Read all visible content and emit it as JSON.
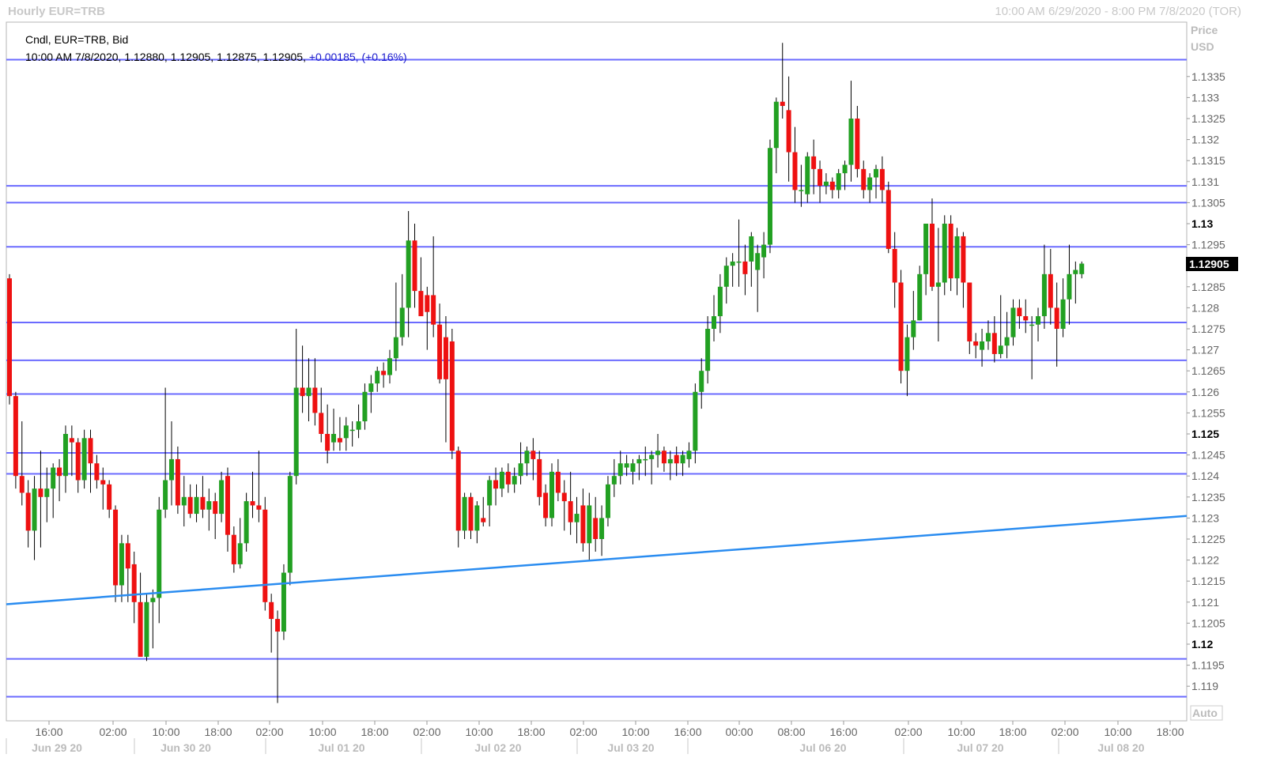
{
  "header": {
    "title": "Hourly EUR=TRB",
    "range": "10:00 AM 6/29/2020 - 8:00 PM 7/8/2020 (TOR)"
  },
  "legend": {
    "line1": "Cndl, EUR=TRB, Bid",
    "ohlc": "10:00 AM 7/8/2020, 1.12880, 1.12905, 1.12875, 1.12905,",
    "change": "+0.00185,",
    "change_pct": "(+0.16%)"
  },
  "axis": {
    "price_label": "Price",
    "currency_label": "USD",
    "auto_label": "Auto",
    "last_price": "1.12905"
  },
  "colors": {
    "up": "#22a022",
    "down": "#ee1111",
    "hline": "#6b6bff",
    "trendline": "#2a8cf0",
    "grid": "#dcdcdc",
    "last_price_bg": "#000000"
  },
  "chart_data": {
    "type": "candlestick",
    "title": "Hourly EUR=TRB",
    "ylim": [
      1.1185,
      1.1345
    ],
    "y_ticks": [
      "1.119",
      "1.1195",
      "1.12",
      "1.1205",
      "1.121",
      "1.1215",
      "1.122",
      "1.1225",
      "1.123",
      "1.1235",
      "1.124",
      "1.1245",
      "1.125",
      "1.1255",
      "1.126",
      "1.1265",
      "1.127",
      "1.1275",
      "1.128",
      "1.1285",
      "1.129",
      "1.1295",
      "1.13",
      "1.1305",
      "1.131",
      "1.1315",
      "1.132",
      "1.1325",
      "1.133",
      "1.1335"
    ],
    "bold_ticks": [
      "1.12",
      "1.125",
      "1.13"
    ],
    "x_time_ticks": [
      "16:00",
      "02:00",
      "10:00",
      "18:00",
      "02:00",
      "10:00",
      "18:00",
      "02:00",
      "10:00",
      "18:00",
      "02:00",
      "10:00",
      "16:00",
      "00:00",
      "08:00",
      "16:00",
      "02:00",
      "10:00",
      "18:00",
      "02:00",
      "10:00",
      "18:00"
    ],
    "x_date_ticks": [
      "Jun 29 20",
      "Jun 30 20",
      "Jul 01 20",
      "Jul 02 20",
      "Jul 03 20",
      "Jul 06 20",
      "Jul 07 20",
      "Jul 08 20"
    ],
    "horizontal_lines": [
      1.1339,
      1.1309,
      1.1305,
      1.12945,
      1.12765,
      1.12675,
      1.12595,
      1.12455,
      1.12405,
      1.11965,
      1.11875
    ],
    "trendline": {
      "start": 1.12095,
      "end": 1.12305
    },
    "candles": [
      {
        "o": 1.1287,
        "h": 1.1288,
        "l": 1.1257,
        "c": 1.1259
      },
      {
        "o": 1.1259,
        "h": 1.126,
        "l": 1.1237,
        "c": 1.124
      },
      {
        "o": 1.124,
        "h": 1.1253,
        "l": 1.1233,
        "c": 1.1236
      },
      {
        "o": 1.1236,
        "h": 1.1239,
        "l": 1.1223,
        "c": 1.1227
      },
      {
        "o": 1.1227,
        "h": 1.124,
        "l": 1.122,
        "c": 1.1237
      },
      {
        "o": 1.1237,
        "h": 1.1246,
        "l": 1.1223,
        "c": 1.1235
      },
      {
        "o": 1.1235,
        "h": 1.1242,
        "l": 1.1229,
        "c": 1.1237
      },
      {
        "o": 1.1237,
        "h": 1.1243,
        "l": 1.123,
        "c": 1.1242
      },
      {
        "o": 1.1242,
        "h": 1.1244,
        "l": 1.1234,
        "c": 1.124
      },
      {
        "o": 1.124,
        "h": 1.1252,
        "l": 1.1236,
        "c": 1.125
      },
      {
        "o": 1.1249,
        "h": 1.1252,
        "l": 1.124,
        "c": 1.1248
      },
      {
        "o": 1.1248,
        "h": 1.1249,
        "l": 1.1236,
        "c": 1.1239
      },
      {
        "o": 1.1239,
        "h": 1.1251,
        "l": 1.1237,
        "c": 1.1249
      },
      {
        "o": 1.1249,
        "h": 1.1251,
        "l": 1.1236,
        "c": 1.1243
      },
      {
        "o": 1.1243,
        "h": 1.1245,
        "l": 1.1237,
        "c": 1.1239
      },
      {
        "o": 1.1239,
        "h": 1.1242,
        "l": 1.1232,
        "c": 1.1238
      },
      {
        "o": 1.1238,
        "h": 1.1239,
        "l": 1.123,
        "c": 1.1232
      },
      {
        "o": 1.1232,
        "h": 1.1233,
        "l": 1.121,
        "c": 1.1214
      },
      {
        "o": 1.1214,
        "h": 1.1226,
        "l": 1.121,
        "c": 1.1224
      },
      {
        "o": 1.1224,
        "h": 1.1226,
        "l": 1.121,
        "c": 1.1218
      },
      {
        "o": 1.1219,
        "h": 1.1222,
        "l": 1.1205,
        "c": 1.121
      },
      {
        "o": 1.121,
        "h": 1.1217,
        "l": 1.1198,
        "c": 1.1197
      },
      {
        "o": 1.1197,
        "h": 1.1212,
        "l": 1.1196,
        "c": 1.121
      },
      {
        "o": 1.121,
        "h": 1.1213,
        "l": 1.1199,
        "c": 1.1211
      },
      {
        "o": 1.1211,
        "h": 1.1235,
        "l": 1.1205,
        "c": 1.1232
      },
      {
        "o": 1.1232,
        "h": 1.1261,
        "l": 1.123,
        "c": 1.1239
      },
      {
        "o": 1.1239,
        "h": 1.1253,
        "l": 1.1233,
        "c": 1.1244
      },
      {
        "o": 1.1244,
        "h": 1.1247,
        "l": 1.1231,
        "c": 1.1233
      },
      {
        "o": 1.1233,
        "h": 1.124,
        "l": 1.1228,
        "c": 1.1235
      },
      {
        "o": 1.1235,
        "h": 1.1238,
        "l": 1.123,
        "c": 1.1231
      },
      {
        "o": 1.1231,
        "h": 1.1238,
        "l": 1.1229,
        "c": 1.1235
      },
      {
        "o": 1.1235,
        "h": 1.124,
        "l": 1.123,
        "c": 1.1232
      },
      {
        "o": 1.1232,
        "h": 1.1237,
        "l": 1.1227,
        "c": 1.1234
      },
      {
        "o": 1.1234,
        "h": 1.1236,
        "l": 1.1225,
        "c": 1.1231
      },
      {
        "o": 1.1231,
        "h": 1.1241,
        "l": 1.1229,
        "c": 1.1239
      },
      {
        "o": 1.124,
        "h": 1.1242,
        "l": 1.1222,
        "c": 1.1226
      },
      {
        "o": 1.1226,
        "h": 1.1228,
        "l": 1.1217,
        "c": 1.1219
      },
      {
        "o": 1.1219,
        "h": 1.123,
        "l": 1.1218,
        "c": 1.1224
      },
      {
        "o": 1.1224,
        "h": 1.1236,
        "l": 1.1222,
        "c": 1.1234
      },
      {
        "o": 1.1234,
        "h": 1.1241,
        "l": 1.123,
        "c": 1.1233
      },
      {
        "o": 1.1233,
        "h": 1.1246,
        "l": 1.1229,
        "c": 1.1232
      },
      {
        "o": 1.1232,
        "h": 1.1235,
        "l": 1.1208,
        "c": 1.121
      },
      {
        "o": 1.121,
        "h": 1.1212,
        "l": 1.1198,
        "c": 1.1206
      },
      {
        "o": 1.1206,
        "h": 1.1208,
        "l": 1.1186,
        "c": 1.1203
      },
      {
        "o": 1.1203,
        "h": 1.1219,
        "l": 1.1201,
        "c": 1.1217
      },
      {
        "o": 1.1217,
        "h": 1.1241,
        "l": 1.1214,
        "c": 1.124
      },
      {
        "o": 1.124,
        "h": 1.1275,
        "l": 1.1238,
        "c": 1.1261
      },
      {
        "o": 1.1261,
        "h": 1.1271,
        "l": 1.1255,
        "c": 1.1259
      },
      {
        "o": 1.1259,
        "h": 1.1268,
        "l": 1.1253,
        "c": 1.1261
      },
      {
        "o": 1.1261,
        "h": 1.1268,
        "l": 1.1252,
        "c": 1.1255
      },
      {
        "o": 1.1255,
        "h": 1.1261,
        "l": 1.1248,
        "c": 1.125
      },
      {
        "o": 1.125,
        "h": 1.1257,
        "l": 1.1243,
        "c": 1.1246
      },
      {
        "o": 1.1248,
        "h": 1.1256,
        "l": 1.1246,
        "c": 1.125
      },
      {
        "o": 1.1249,
        "h": 1.1254,
        "l": 1.1246,
        "c": 1.1248
      },
      {
        "o": 1.1249,
        "h": 1.1254,
        "l": 1.1246,
        "c": 1.1252
      },
      {
        "o": 1.1251,
        "h": 1.1253,
        "l": 1.1247,
        "c": 1.1251
      },
      {
        "o": 1.1251,
        "h": 1.1257,
        "l": 1.1249,
        "c": 1.1253
      },
      {
        "o": 1.1253,
        "h": 1.1262,
        "l": 1.1251,
        "c": 1.126
      },
      {
        "o": 1.126,
        "h": 1.1264,
        "l": 1.1255,
        "c": 1.1262
      },
      {
        "o": 1.1262,
        "h": 1.1266,
        "l": 1.126,
        "c": 1.1265
      },
      {
        "o": 1.1265,
        "h": 1.1267,
        "l": 1.1261,
        "c": 1.1264
      },
      {
        "o": 1.1264,
        "h": 1.127,
        "l": 1.1262,
        "c": 1.1268
      },
      {
        "o": 1.1268,
        "h": 1.1286,
        "l": 1.1265,
        "c": 1.1273
      },
      {
        "o": 1.1273,
        "h": 1.1288,
        "l": 1.1271,
        "c": 1.128
      },
      {
        "o": 1.128,
        "h": 1.1303,
        "l": 1.1273,
        "c": 1.1296
      },
      {
        "o": 1.1296,
        "h": 1.13,
        "l": 1.128,
        "c": 1.1284
      },
      {
        "o": 1.1284,
        "h": 1.1292,
        "l": 1.128,
        "c": 1.1278
      },
      {
        "o": 1.1283,
        "h": 1.1285,
        "l": 1.127,
        "c": 1.1279
      },
      {
        "o": 1.1283,
        "h": 1.1297,
        "l": 1.1273,
        "c": 1.1276
      },
      {
        "o": 1.1276,
        "h": 1.1281,
        "l": 1.1262,
        "c": 1.1263
      },
      {
        "o": 1.1273,
        "h": 1.1278,
        "l": 1.1248,
        "c": 1.1263
      },
      {
        "o": 1.1272,
        "h": 1.1275,
        "l": 1.1244,
        "c": 1.1246
      },
      {
        "o": 1.1246,
        "h": 1.1247,
        "l": 1.1223,
        "c": 1.1227
      },
      {
        "o": 1.1227,
        "h": 1.1236,
        "l": 1.1225,
        "c": 1.1235
      },
      {
        "o": 1.1235,
        "h": 1.1236,
        "l": 1.1225,
        "c": 1.1227
      },
      {
        "o": 1.1227,
        "h": 1.1234,
        "l": 1.1224,
        "c": 1.1233
      },
      {
        "o": 1.123,
        "h": 1.1235,
        "l": 1.1228,
        "c": 1.1229
      },
      {
        "o": 1.1233,
        "h": 1.124,
        "l": 1.1228,
        "c": 1.1239
      },
      {
        "o": 1.1239,
        "h": 1.1242,
        "l": 1.1233,
        "c": 1.1237
      },
      {
        "o": 1.1237,
        "h": 1.1242,
        "l": 1.1235,
        "c": 1.1241
      },
      {
        "o": 1.1241,
        "h": 1.1243,
        "l": 1.1236,
        "c": 1.1238
      },
      {
        "o": 1.1238,
        "h": 1.1242,
        "l": 1.1236,
        "c": 1.124
      },
      {
        "o": 1.124,
        "h": 1.1248,
        "l": 1.1238,
        "c": 1.1243
      },
      {
        "o": 1.1243,
        "h": 1.1247,
        "l": 1.124,
        "c": 1.1246
      },
      {
        "o": 1.1246,
        "h": 1.1249,
        "l": 1.1239,
        "c": 1.1244
      },
      {
        "o": 1.1244,
        "h": 1.1246,
        "l": 1.1233,
        "c": 1.1235
      },
      {
        "o": 1.1236,
        "h": 1.1238,
        "l": 1.1228,
        "c": 1.123
      },
      {
        "o": 1.123,
        "h": 1.1243,
        "l": 1.1228,
        "c": 1.1241
      },
      {
        "o": 1.1241,
        "h": 1.1244,
        "l": 1.1234,
        "c": 1.1236
      },
      {
        "o": 1.1236,
        "h": 1.1239,
        "l": 1.1227,
        "c": 1.1234
      },
      {
        "o": 1.1234,
        "h": 1.1241,
        "l": 1.1226,
        "c": 1.1229
      },
      {
        "o": 1.1229,
        "h": 1.1235,
        "l": 1.1224,
        "c": 1.1231
      },
      {
        "o": 1.1233,
        "h": 1.1237,
        "l": 1.1222,
        "c": 1.1224
      },
      {
        "o": 1.1224,
        "h": 1.1236,
        "l": 1.122,
        "c": 1.1233
      },
      {
        "o": 1.123,
        "h": 1.1235,
        "l": 1.1222,
        "c": 1.1225
      },
      {
        "o": 1.1225,
        "h": 1.1233,
        "l": 1.1221,
        "c": 1.123
      },
      {
        "o": 1.123,
        "h": 1.124,
        "l": 1.1228,
        "c": 1.1238
      },
      {
        "o": 1.1238,
        "h": 1.1244,
        "l": 1.1235,
        "c": 1.124
      },
      {
        "o": 1.124,
        "h": 1.1246,
        "l": 1.1238,
        "c": 1.1243
      },
      {
        "o": 1.1242,
        "h": 1.1245,
        "l": 1.124,
        "c": 1.1243
      },
      {
        "o": 1.1241,
        "h": 1.1244,
        "l": 1.1238,
        "c": 1.1243
      },
      {
        "o": 1.1243,
        "h": 1.1245,
        "l": 1.1239,
        "c": 1.1244
      },
      {
        "o": 1.1244,
        "h": 1.1247,
        "l": 1.124,
        "c": 1.1244
      },
      {
        "o": 1.1244,
        "h": 1.1246,
        "l": 1.1238,
        "c": 1.1245
      },
      {
        "o": 1.1245,
        "h": 1.125,
        "l": 1.1242,
        "c": 1.1246
      },
      {
        "o": 1.1246,
        "h": 1.1247,
        "l": 1.1241,
        "c": 1.1243
      },
      {
        "o": 1.1243,
        "h": 1.1246,
        "l": 1.1239,
        "c": 1.1244
      },
      {
        "o": 1.1245,
        "h": 1.1247,
        "l": 1.124,
        "c": 1.1243
      },
      {
        "o": 1.1243,
        "h": 1.1246,
        "l": 1.124,
        "c": 1.1245
      },
      {
        "o": 1.1244,
        "h": 1.1248,
        "l": 1.1242,
        "c": 1.1246
      },
      {
        "o": 1.1246,
        "h": 1.1262,
        "l": 1.1243,
        "c": 1.126
      },
      {
        "o": 1.126,
        "h": 1.1268,
        "l": 1.1256,
        "c": 1.1265
      },
      {
        "o": 1.1265,
        "h": 1.1278,
        "l": 1.1262,
        "c": 1.1275
      },
      {
        "o": 1.1275,
        "h": 1.1283,
        "l": 1.1272,
        "c": 1.1278
      },
      {
        "o": 1.1278,
        "h": 1.1288,
        "l": 1.1274,
        "c": 1.1285
      },
      {
        "o": 1.1285,
        "h": 1.1292,
        "l": 1.1281,
        "c": 1.129
      },
      {
        "o": 1.129,
        "h": 1.1293,
        "l": 1.1285,
        "c": 1.1291
      },
      {
        "o": 1.1291,
        "h": 1.1301,
        "l": 1.1285,
        "c": 1.1291
      },
      {
        "o": 1.1291,
        "h": 1.1295,
        "l": 1.1283,
        "c": 1.1288
      },
      {
        "o": 1.1291,
        "h": 1.1298,
        "l": 1.1285,
        "c": 1.1297
      },
      {
        "o": 1.1289,
        "h": 1.1295,
        "l": 1.1279,
        "c": 1.1293
      },
      {
        "o": 1.1292,
        "h": 1.1298,
        "l": 1.1287,
        "c": 1.1295
      },
      {
        "o": 1.1295,
        "h": 1.132,
        "l": 1.1293,
        "c": 1.1318
      },
      {
        "o": 1.1318,
        "h": 1.133,
        "l": 1.1312,
        "c": 1.1329
      },
      {
        "o": 1.1329,
        "h": 1.1343,
        "l": 1.1325,
        "c": 1.1328
      },
      {
        "o": 1.1327,
        "h": 1.1335,
        "l": 1.131,
        "c": 1.1317
      },
      {
        "o": 1.1317,
        "h": 1.1323,
        "l": 1.1305,
        "c": 1.1308
      },
      {
        "o": 1.1308,
        "h": 1.1314,
        "l": 1.1304,
        "c": 1.1308
      },
      {
        "o": 1.1307,
        "h": 1.1317,
        "l": 1.1305,
        "c": 1.1316
      },
      {
        "o": 1.1316,
        "h": 1.132,
        "l": 1.1307,
        "c": 1.1313
      },
      {
        "o": 1.1313,
        "h": 1.1315,
        "l": 1.1305,
        "c": 1.1309
      },
      {
        "o": 1.1309,
        "h": 1.1312,
        "l": 1.1307,
        "c": 1.131
      },
      {
        "o": 1.131,
        "h": 1.1311,
        "l": 1.1306,
        "c": 1.1308
      },
      {
        "o": 1.1308,
        "h": 1.1313,
        "l": 1.1306,
        "c": 1.1312
      },
      {
        "o": 1.1312,
        "h": 1.1315,
        "l": 1.1308,
        "c": 1.1314
      },
      {
        "o": 1.1314,
        "h": 1.1334,
        "l": 1.131,
        "c": 1.1325
      },
      {
        "o": 1.1325,
        "h": 1.1328,
        "l": 1.1311,
        "c": 1.1313
      },
      {
        "o": 1.1313,
        "h": 1.1315,
        "l": 1.1306,
        "c": 1.1308
      },
      {
        "o": 1.1308,
        "h": 1.1312,
        "l": 1.1305,
        "c": 1.1311
      },
      {
        "o": 1.1311,
        "h": 1.1314,
        "l": 1.1306,
        "c": 1.1313
      },
      {
        "o": 1.1313,
        "h": 1.1316,
        "l": 1.1305,
        "c": 1.1308
      },
      {
        "o": 1.1308,
        "h": 1.131,
        "l": 1.1293,
        "c": 1.1294
      },
      {
        "o": 1.1294,
        "h": 1.1298,
        "l": 1.128,
        "c": 1.1286
      },
      {
        "o": 1.1286,
        "h": 1.1289,
        "l": 1.1262,
        "c": 1.1265
      },
      {
        "o": 1.1265,
        "h": 1.1276,
        "l": 1.1259,
        "c": 1.1273
      },
      {
        "o": 1.1273,
        "h": 1.1284,
        "l": 1.127,
        "c": 1.1277
      },
      {
        "o": 1.1277,
        "h": 1.129,
        "l": 1.1277,
        "c": 1.1288
      },
      {
        "o": 1.1288,
        "h": 1.13,
        "l": 1.1283,
        "c": 1.13
      },
      {
        "o": 1.13,
        "h": 1.1306,
        "l": 1.1284,
        "c": 1.1285
      },
      {
        "o": 1.1285,
        "h": 1.1299,
        "l": 1.1272,
        "c": 1.1286
      },
      {
        "o": 1.1286,
        "h": 1.1302,
        "l": 1.1283,
        "c": 1.13
      },
      {
        "o": 1.13,
        "h": 1.1302,
        "l": 1.1284,
        "c": 1.1287
      },
      {
        "o": 1.1287,
        "h": 1.1299,
        "l": 1.1283,
        "c": 1.1297
      },
      {
        "o": 1.1297,
        "h": 1.1298,
        "l": 1.128,
        "c": 1.1286
      },
      {
        "o": 1.1286,
        "h": 1.1286,
        "l": 1.1269,
        "c": 1.1272
      },
      {
        "o": 1.1272,
        "h": 1.1274,
        "l": 1.1268,
        "c": 1.1271
      },
      {
        "o": 1.127,
        "h": 1.1275,
        "l": 1.1266,
        "c": 1.1272
      },
      {
        "o": 1.1272,
        "h": 1.1277,
        "l": 1.127,
        "c": 1.1274
      },
      {
        "o": 1.1274,
        "h": 1.1278,
        "l": 1.1267,
        "c": 1.1269
      },
      {
        "o": 1.1269,
        "h": 1.1283,
        "l": 1.1268,
        "c": 1.1271
      },
      {
        "o": 1.1271,
        "h": 1.1279,
        "l": 1.1268,
        "c": 1.1273
      },
      {
        "o": 1.1273,
        "h": 1.1282,
        "l": 1.1271,
        "c": 1.128
      },
      {
        "o": 1.128,
        "h": 1.1282,
        "l": 1.1275,
        "c": 1.1278
      },
      {
        "o": 1.1278,
        "h": 1.1282,
        "l": 1.1274,
        "c": 1.1277
      },
      {
        "o": 1.1276,
        "h": 1.1278,
        "l": 1.1263,
        "c": 1.1276
      },
      {
        "o": 1.1276,
        "h": 1.128,
        "l": 1.1272,
        "c": 1.1278
      },
      {
        "o": 1.1278,
        "h": 1.1295,
        "l": 1.1275,
        "c": 1.1288
      },
      {
        "o": 1.1288,
        "h": 1.1294,
        "l": 1.1276,
        "c": 1.128
      },
      {
        "o": 1.128,
        "h": 1.1286,
        "l": 1.1266,
        "c": 1.1275
      },
      {
        "o": 1.1275,
        "h": 1.1287,
        "l": 1.1273,
        "c": 1.1282
      },
      {
        "o": 1.1282,
        "h": 1.1295,
        "l": 1.1276,
        "c": 1.1288
      },
      {
        "o": 1.1288,
        "h": 1.1291,
        "l": 1.1281,
        "c": 1.1289
      },
      {
        "o": 1.1288,
        "h": 1.1291,
        "l": 1.1287,
        "c": 1.12905
      }
    ]
  }
}
